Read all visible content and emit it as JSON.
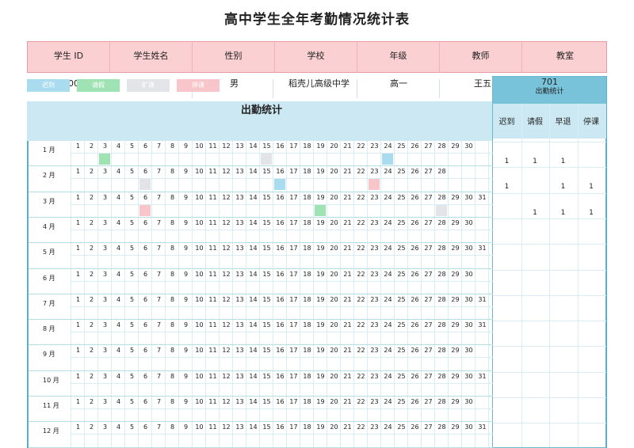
{
  "title": "高中学生全年考勤情况统计表",
  "header": [
    "学生 ID",
    "学生姓名",
    "性别",
    "学校",
    "年级",
    "教师",
    "教室"
  ],
  "student": {
    "id_fragment": "00",
    "gender": "男",
    "school": "稻壳儿高级中学",
    "grade": "高一",
    "teacher": "王五",
    "room": "701"
  },
  "legend": [
    {
      "label": "迟到",
      "color": "#a9dcee"
    },
    {
      "label": "请假",
      "color": "#9fe3b5"
    },
    {
      "label": "旷课",
      "color": "#e2e4e8"
    },
    {
      "label": "停课",
      "color": "#f8c6ca"
    }
  ],
  "section_title": "出勤统计",
  "summary_title": "出勤统计",
  "summary_cols": [
    "迟到",
    "请假",
    "早退",
    "停课"
  ],
  "months": [
    {
      "label": "1 月",
      "days": 30
    },
    {
      "label": "2 月",
      "days": 28
    },
    {
      "label": "3 月",
      "days": 31
    },
    {
      "label": "4 月",
      "days": 30
    },
    {
      "label": "5 月",
      "days": 31
    },
    {
      "label": "6 月",
      "days": 30
    },
    {
      "label": "7 月",
      "days": 31
    },
    {
      "label": "8 月",
      "days": 31
    },
    {
      "label": "9 月",
      "days": 30
    },
    {
      "label": "10 月",
      "days": 31
    },
    {
      "label": "11 月",
      "days": 30
    },
    {
      "label": "12 月",
      "days": 31
    }
  ],
  "marks": [
    {
      "month": 0,
      "day": 3,
      "type": "请假"
    },
    {
      "month": 0,
      "day": 15,
      "type": "旷课"
    },
    {
      "month": 0,
      "day": 24,
      "type": "迟到"
    },
    {
      "month": 1,
      "day": 6,
      "type": "旷课"
    },
    {
      "month": 1,
      "day": 16,
      "type": "迟到"
    },
    {
      "month": 1,
      "day": 23,
      "type": "停课"
    },
    {
      "month": 2,
      "day": 6,
      "type": "停课"
    },
    {
      "month": 2,
      "day": 19,
      "type": "请假"
    },
    {
      "month": 2,
      "day": 28,
      "type": "旷课"
    }
  ],
  "summary_values": [
    [
      "1",
      "1",
      "1",
      ""
    ],
    [
      "1",
      "",
      "1",
      "1"
    ],
    [
      "",
      "1",
      "1",
      "1"
    ]
  ],
  "colors": {
    "header_pink": "#fbd0d2",
    "section_blue": "#cce9f3",
    "summary_blue": "#79c3da",
    "grid_line": "#d8eef4"
  }
}
